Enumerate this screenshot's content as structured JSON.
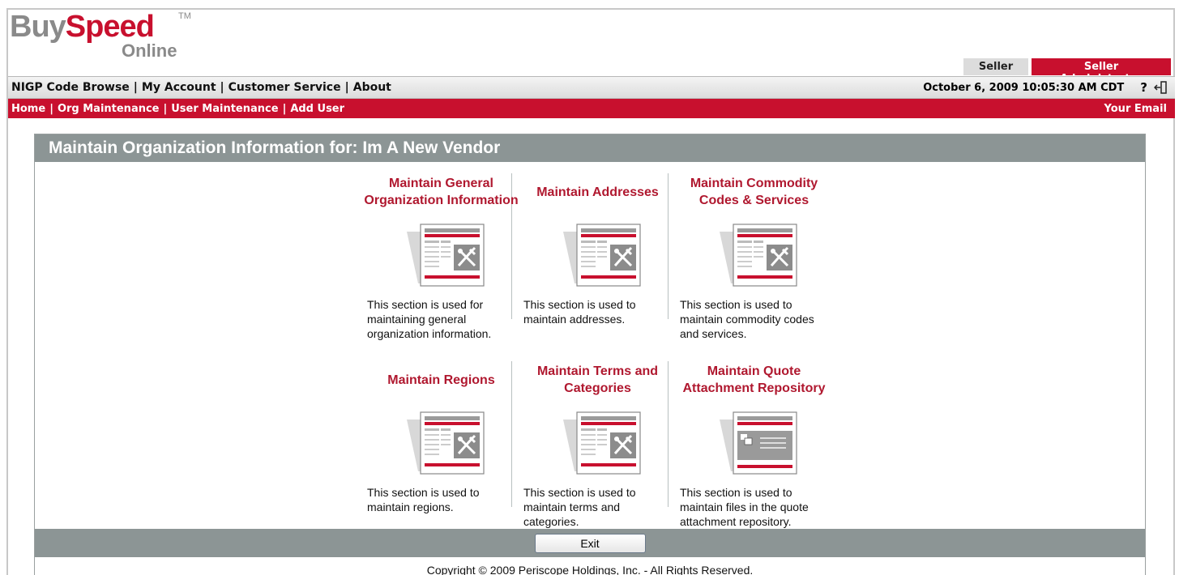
{
  "logo": {
    "buy": "Buy",
    "speed": "Speed",
    "tm": "TM",
    "online": "Online"
  },
  "role_tabs": {
    "seller": "Seller",
    "admin": "Seller Administrator"
  },
  "topnav": {
    "links": [
      "NIGP Code Browse",
      "My Account",
      "Customer Service",
      "About"
    ],
    "datetime": "October 6, 2009 10:05:30 AM CDT",
    "help": "?"
  },
  "rednav": {
    "links": [
      "Home",
      "Org Maintenance",
      "User Maintenance",
      "Add User"
    ],
    "email": "Your Email"
  },
  "panel": {
    "title": "Maintain Organization Information for: Im A New Vendor",
    "sections": [
      {
        "title": "Maintain General Organization Information",
        "desc": "This section is used for maintaining general organization information.",
        "icon": "tools-document-icon"
      },
      {
        "title": "Maintain Addresses",
        "desc": "This section is used to maintain addresses.",
        "icon": "tools-document-icon"
      },
      {
        "title": "Maintain Commodity Codes & Services",
        "desc": "This section is used to maintain commodity codes and services.",
        "icon": "tools-document-icon"
      },
      {
        "title": "Maintain Regions",
        "desc": "This section is used to maintain regions.",
        "icon": "tools-document-icon"
      },
      {
        "title": "Maintain Terms and Categories",
        "desc": "This section is used to maintain terms and categories.",
        "icon": "tools-document-icon"
      },
      {
        "title": "Maintain Quote Attachment Repository",
        "desc": "This section is used to maintain files in the quote attachment repository.",
        "icon": "attachment-document-icon"
      }
    ],
    "exit_label": "Exit",
    "copyright": "Copyright © 2009 Periscope Holdings, Inc. - All Rights Reserved."
  },
  "colors": {
    "brand_red": "#c8102e",
    "panel_grey": "#8c9595",
    "title_red": "#b0182f"
  }
}
